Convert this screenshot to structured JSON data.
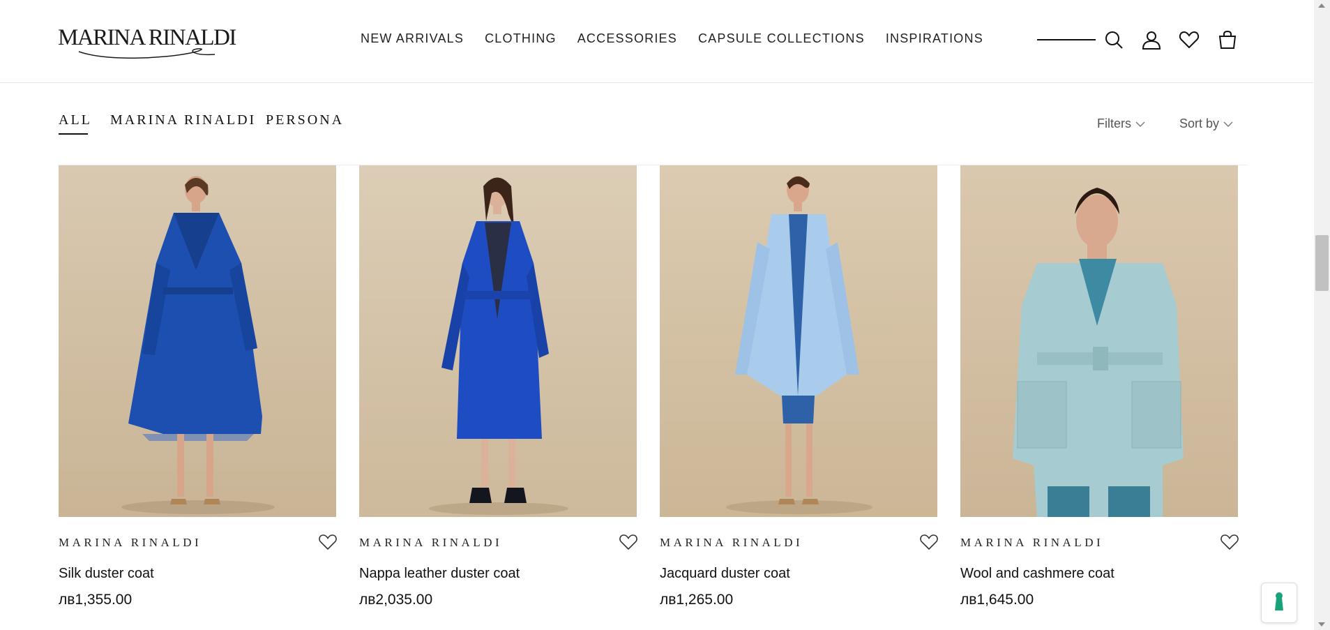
{
  "header": {
    "logo_text": "MARINA RINALDI",
    "nav": [
      "NEW ARRIVALS",
      "CLOTHING",
      "ACCESSORIES",
      "CAPSULE COLLECTIONS",
      "INSPIRATIONS"
    ]
  },
  "categories": {
    "tabs": [
      "ALL",
      "MARINA RINALDI",
      "PERSONA"
    ],
    "active": "ALL"
  },
  "toolbar": {
    "filters_label": "Filters",
    "sort_label": "Sort by"
  },
  "products": [
    {
      "brand": "MARINA RINALDI",
      "name": "Silk duster coat",
      "price": "лв1,355.00"
    },
    {
      "brand": "MARINA RINALDI",
      "name": "Nappa leather duster coat",
      "price": "лв2,035.00"
    },
    {
      "brand": "MARINA RINALDI",
      "name": "Jacquard duster coat",
      "price": "лв1,265.00"
    },
    {
      "brand": "MARINA RINALDI",
      "name": "Wool and cashmere coat",
      "price": "лв1,645.00"
    }
  ],
  "colors": {
    "accent_chat": "#1aa37a",
    "photo_background": "#d6c6ad",
    "coat_colors": [
      "#1c4fb0",
      "#1e4cc2",
      "#a9ccec",
      "#a6cbd0"
    ]
  }
}
